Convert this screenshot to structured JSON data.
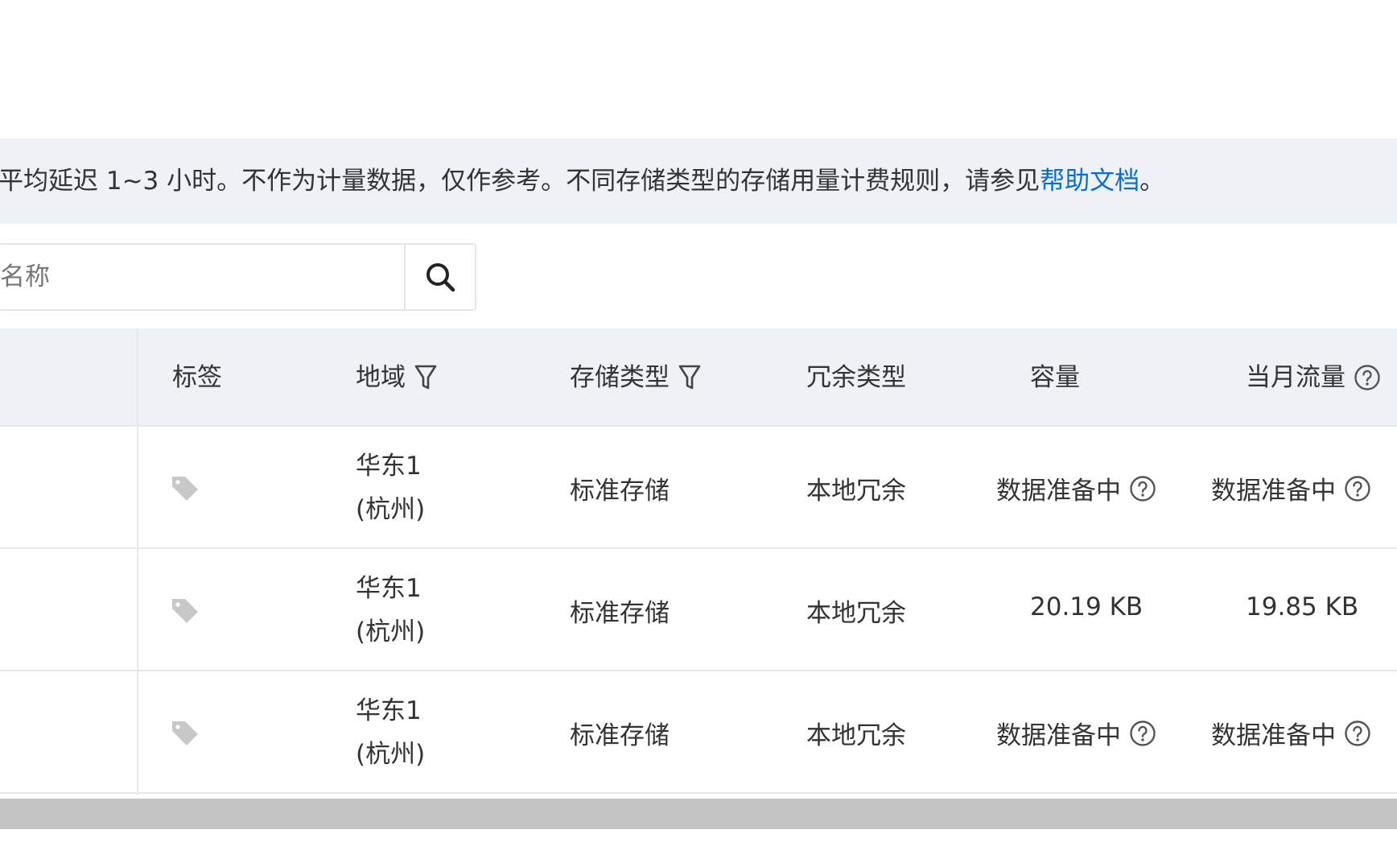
{
  "notice": {
    "text": "平均延迟 1~3 小时。不作为计量数据，仅作参考。不同存储类型的存储用量计费规则，请参见",
    "link": "帮助文档",
    "suffix": "。"
  },
  "search": {
    "placeholder": "名称"
  },
  "table": {
    "headers": {
      "tag": "标签",
      "region": "地域",
      "storage_type": "存储类型",
      "redundancy": "冗余类型",
      "capacity": "容量",
      "monthly_traffic": "当月流量"
    },
    "rows": [
      {
        "region_line1": "华东1",
        "region_line2": "(杭州)",
        "storage_type": "标准存储",
        "redundancy": "本地冗余",
        "capacity": "数据准备中",
        "monthly_traffic": "数据准备中"
      },
      {
        "region_line1": "华东1",
        "region_line2": "(杭州)",
        "storage_type": "标准存储",
        "redundancy": "本地冗余",
        "capacity": "20.19 KB",
        "monthly_traffic": "19.85 KB"
      },
      {
        "region_line1": "华东1",
        "region_line2": "(杭州)",
        "storage_type": "标准存储",
        "redundancy": "本地冗余",
        "capacity": "数据准备中",
        "monthly_traffic": "数据准备中"
      }
    ]
  },
  "colors": {
    "link": "#0b6cd1",
    "header_bg": "#eef1f5",
    "scrollbar": "#c4c4c4"
  },
  "icons": [
    "search-icon",
    "filter-icon",
    "help-icon",
    "tag-icon"
  ]
}
